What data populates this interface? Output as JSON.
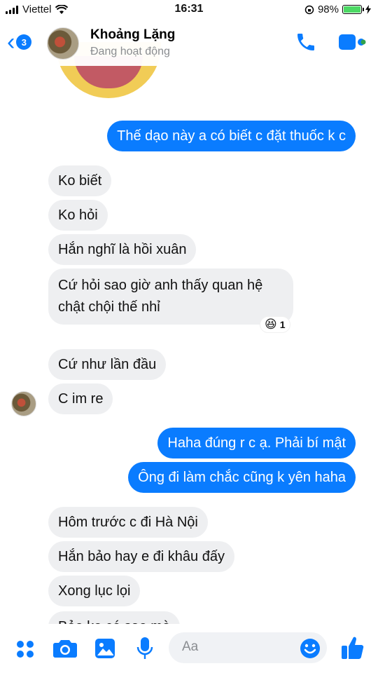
{
  "status_bar": {
    "carrier": "Viettel",
    "time": "16:31",
    "battery_percent": "98%",
    "battery_level": 0.98
  },
  "header": {
    "back_count": "3",
    "contact_name": "Khoảng Lặng",
    "contact_status": "Đang hoạt động"
  },
  "messages": [
    {
      "side": "out",
      "text": "Thế dạo này a có biết c đặt thuốc k c"
    },
    {
      "side": "in",
      "text": "Ko biết"
    },
    {
      "side": "in",
      "text": "Ko hỏi"
    },
    {
      "side": "in",
      "text": "Hắn nghĩ là hồi xuân"
    },
    {
      "side": "in",
      "text": "Cứ hỏi sao giờ anh thấy quan hệ chật chội thế nhỉ",
      "reaction": {
        "emoji": "😆",
        "count": "1"
      }
    },
    {
      "side": "in",
      "text": "Cứ như lần đầu"
    },
    {
      "side": "in",
      "text": "C im re"
    },
    {
      "side": "out",
      "text": "Haha đúng r c ạ. Phải bí mật"
    },
    {
      "side": "out",
      "text": "Ông đi làm chắc cũng k yên haha"
    },
    {
      "side": "in",
      "text": "Hôm trước c đi Hà Nội"
    },
    {
      "side": "in",
      "text": "Hắn bảo hay e đi khâu đấy"
    },
    {
      "side": "in",
      "text": "Xong lục lọi"
    },
    {
      "side": "in",
      "text": "Bảo ko có sao mà"
    }
  ],
  "composer": {
    "placeholder": "Aa",
    "icons": [
      "menu-dots-icon",
      "camera-icon",
      "image-icon",
      "microphone-icon",
      "emoji-icon",
      "thumbs-up-icon"
    ]
  },
  "colors": {
    "accent": "#0a7cff",
    "incoming_bubble": "#eeeff1",
    "battery": "#4cd964"
  }
}
